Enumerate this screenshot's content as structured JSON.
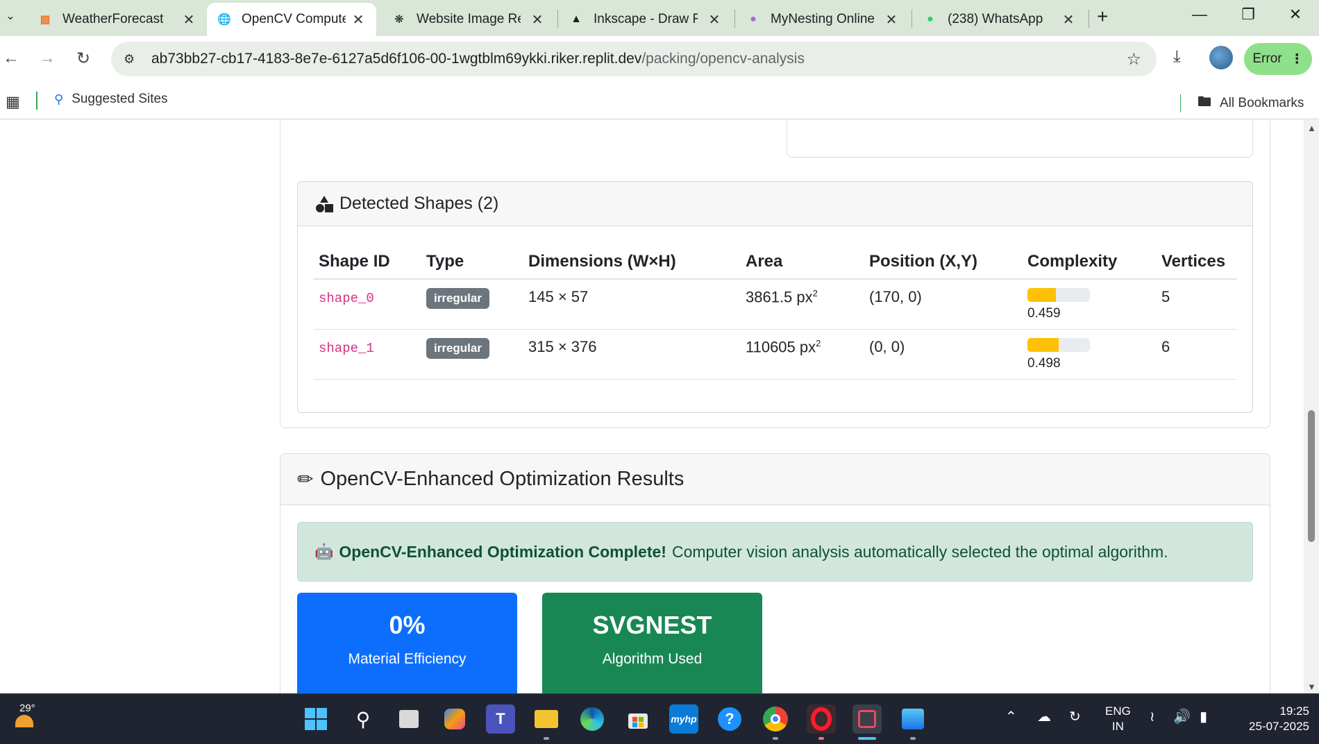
{
  "browser": {
    "tabs": [
      {
        "label": "WeatherForecast -",
        "icon": "replit-icon"
      },
      {
        "label": "OpenCV Compute",
        "icon": "globe-icon"
      },
      {
        "label": "Website Image Re",
        "icon": "openai-icon"
      },
      {
        "label": "Inkscape - Draw Fr",
        "icon": "inkscape-icon"
      },
      {
        "label": "MyNesting Online",
        "icon": "mynesting-icon"
      },
      {
        "label": "(238) WhatsApp",
        "icon": "whatsapp-icon"
      }
    ],
    "url_host": "ab73bb27-cb17-4183-8e7e-6127a5d6f106-00-1wgtblm69ykki.riker.replit.dev",
    "url_path": "/packing/opencv-analysis",
    "profile_status": "Error",
    "bookmarks": {
      "suggested": "Suggested Sites",
      "all": "All Bookmarks"
    }
  },
  "shapes_card": {
    "title": "Detected Shapes (2)",
    "columns": [
      "Shape ID",
      "Type",
      "Dimensions (W×H)",
      "Area",
      "Position (X,Y)",
      "Complexity",
      "Vertices"
    ],
    "rows": [
      {
        "id": "shape_0",
        "type": "irregular",
        "dims": "145 × 57",
        "area": "3861.5 px",
        "area_sup": "2",
        "position": "(170, 0)",
        "complexity": 0.459,
        "complexity_label": "0.459",
        "vertices": "5"
      },
      {
        "id": "shape_1",
        "type": "irregular",
        "dims": "315 × 376",
        "area": "110605 px",
        "area_sup": "2",
        "position": "(0, 0)",
        "complexity": 0.498,
        "complexity_label": "0.498",
        "vertices": "6"
      }
    ]
  },
  "optimization": {
    "title": "OpenCV-Enhanced Optimization Results",
    "alert_bold": "OpenCV-Enhanced Optimization Complete!",
    "alert_text": "Computer vision analysis automatically selected the optimal algorithm.",
    "stats": [
      {
        "value": "0%",
        "label": "Material Efficiency",
        "color": "#0d6efd"
      },
      {
        "value": "SVGNEST",
        "label": "Algorithm Used",
        "color": "#198754"
      }
    ]
  },
  "taskbar": {
    "temperature": "29°",
    "lang_primary": "ENG",
    "lang_secondary": "IN",
    "time": "19:25",
    "date": "25-07-2025"
  },
  "colors": {
    "badge": "#6c757d",
    "shape_id": "#d63384",
    "complexity_fill": "#ffc107",
    "alert_bg": "#d1e7dd"
  }
}
